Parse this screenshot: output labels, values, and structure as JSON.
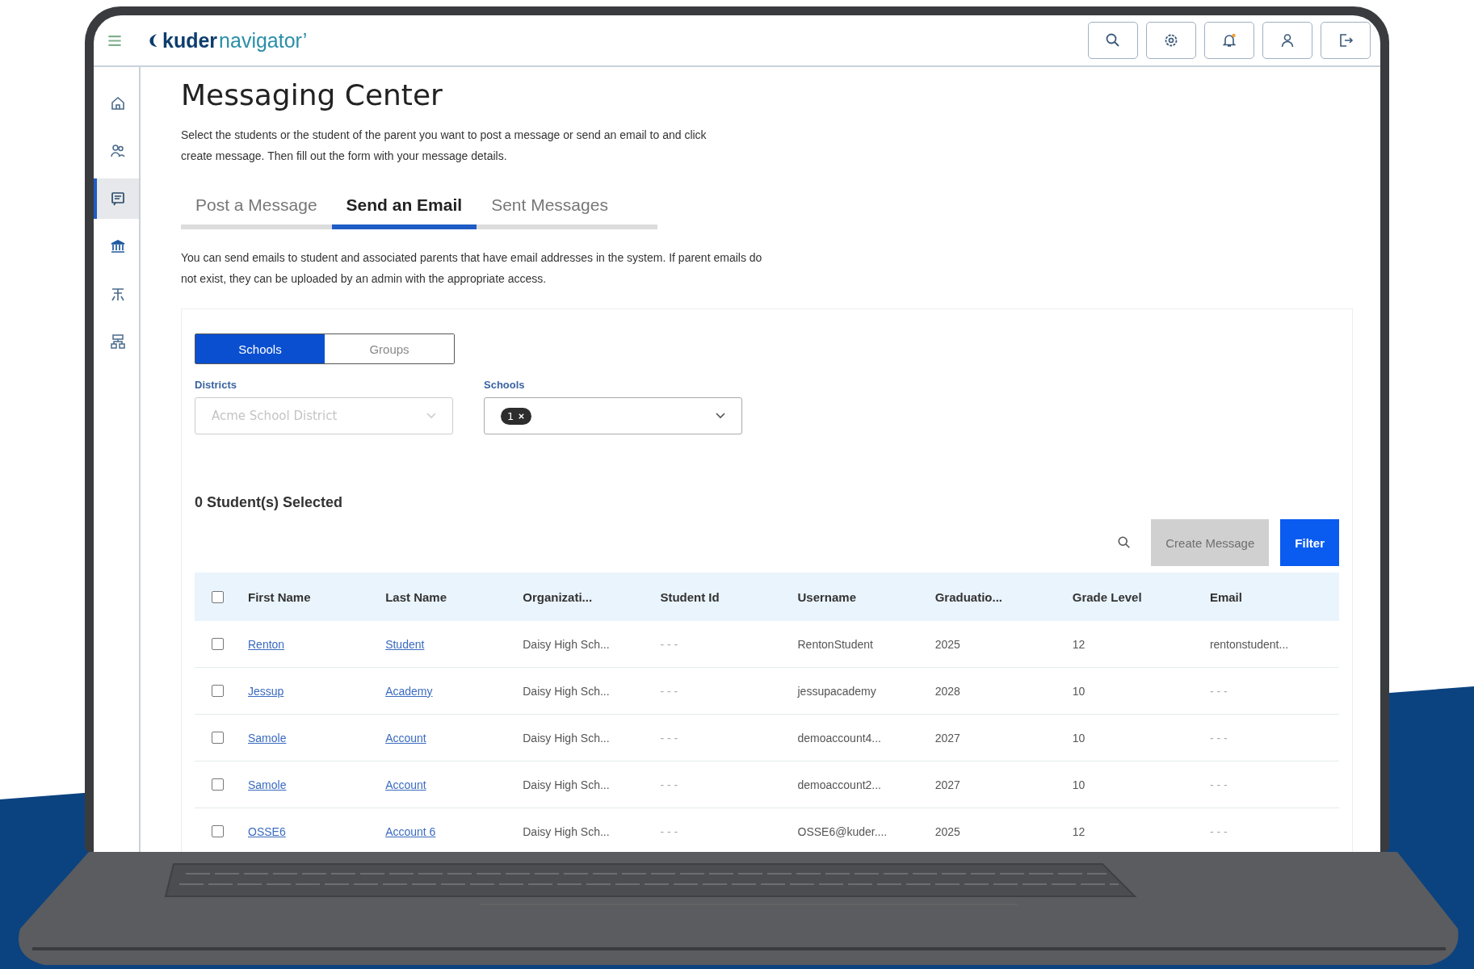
{
  "logo": {
    "bold": "kuder",
    "light": "navigator’"
  },
  "top_buttons": [
    {
      "kind": "search"
    },
    {
      "kind": "settings"
    },
    {
      "kind": "bell",
      "notification": true
    },
    {
      "kind": "user"
    },
    {
      "kind": "logout"
    }
  ],
  "sidebar": {
    "items": [
      {
        "kind": "home",
        "selected": false
      },
      {
        "kind": "people",
        "selected": false
      },
      {
        "kind": "message",
        "selected": true
      },
      {
        "kind": "institution",
        "selected": false
      },
      {
        "kind": "career",
        "selected": false
      },
      {
        "kind": "sitemap",
        "selected": false
      }
    ]
  },
  "page": {
    "title": "Messaging Center",
    "intro": "Select the students or the student of the parent you want to post a message or send an email to and click create message. Then fill out the form with your message details."
  },
  "tabs": [
    {
      "label": "Post a Message",
      "selected": false
    },
    {
      "label": "Send an Email",
      "selected": true
    },
    {
      "label": "Sent Messages",
      "selected": false
    }
  ],
  "tab_note": "You can send emails to student and associated parents that have email addresses in the system. If parent emails do not exist, they can be uploaded by an admin with the appropriate access.",
  "toggle": [
    {
      "label": "Schools",
      "selected": true
    },
    {
      "label": "Groups",
      "selected": false
    }
  ],
  "filters": [
    {
      "label": "Districts",
      "kind": "text",
      "value": "Acme School District",
      "disabled": true
    },
    {
      "label": "Schools",
      "kind": "chips",
      "chip": "1",
      "disabled": false
    }
  ],
  "selected_count": "0 Student(s) Selected",
  "actions": [
    {
      "label": "Create Message",
      "disabled": true
    },
    {
      "label": "Filter",
      "disabled": false
    }
  ],
  "table": {
    "select_all": {
      "checked": false
    },
    "columns": [
      "First Name",
      "Last Name",
      "Organizati...",
      "Student Id",
      "Username",
      "Graduatio...",
      "Grade Level",
      "Email"
    ],
    "rows": [
      {
        "checked": false,
        "cells": [
          "Renton",
          "Student",
          "Daisy High Sch...",
          "- - -",
          "RentonStudent",
          "2025",
          "12",
          "rentonstudent..."
        ]
      },
      {
        "checked": false,
        "cells": [
          "Jessup",
          "Academy",
          "Daisy High Sch...",
          "- - -",
          "jessupacademy",
          "2028",
          "10",
          "- - -"
        ]
      },
      {
        "checked": false,
        "cells": [
          "Samole",
          "Account",
          "Daisy High Sch...",
          "- - -",
          "demoaccount4...",
          "2027",
          "10",
          "- - -"
        ]
      },
      {
        "checked": false,
        "cells": [
          "Samole",
          "Account",
          "Daisy High Sch...",
          "- - -",
          "demoaccount2...",
          "2027",
          "10",
          "- - -"
        ]
      },
      {
        "checked": false,
        "cells": [
          "OSSE6",
          "Account 6",
          "Daisy High Sch...",
          "- - -",
          "OSSE6@kuder....",
          "2025",
          "12",
          "- - -"
        ]
      }
    ]
  }
}
